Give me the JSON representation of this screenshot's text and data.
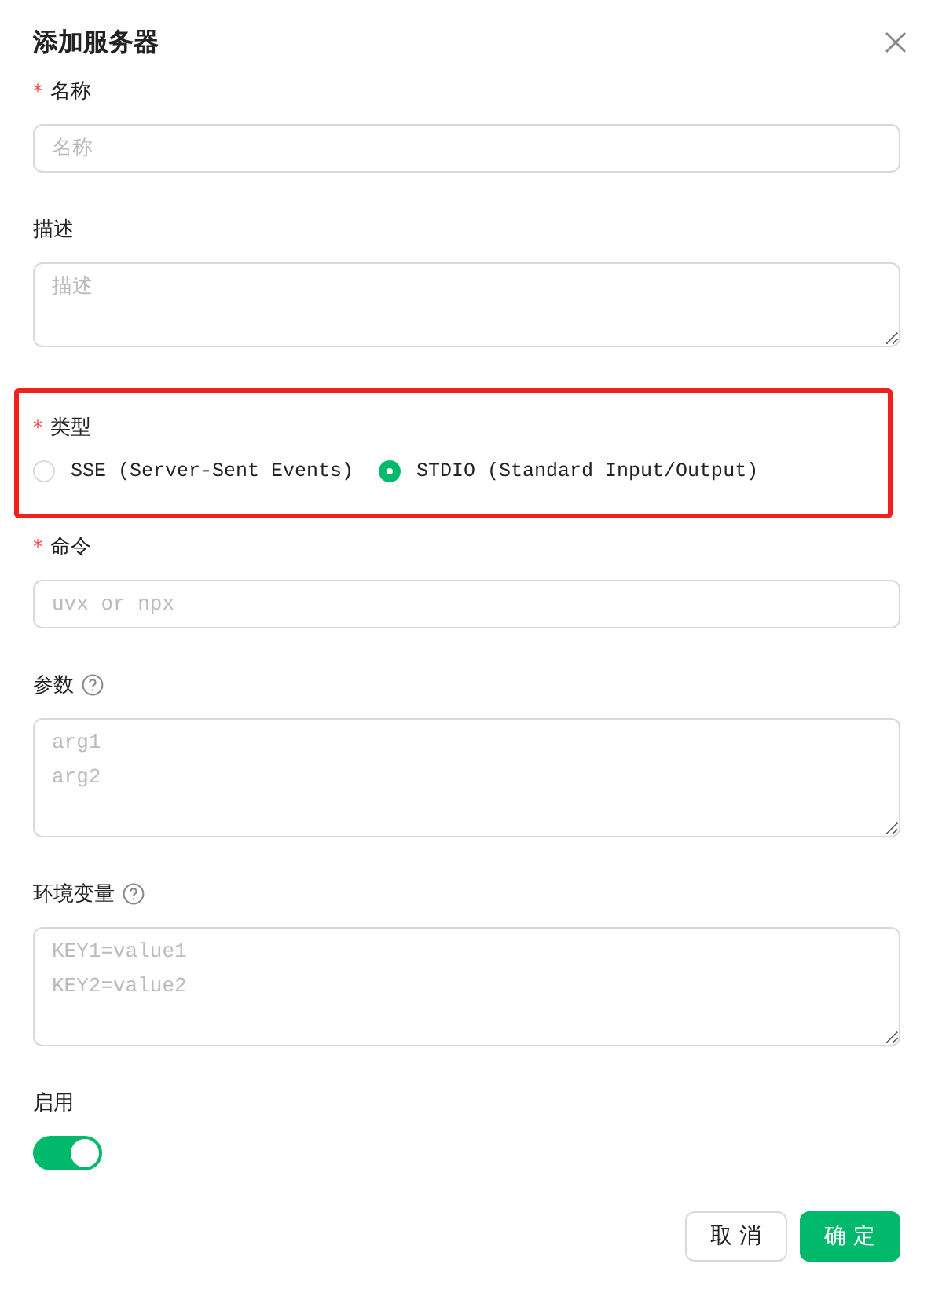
{
  "dialog": {
    "title": "添加服务器"
  },
  "fields": [
    {
      "kind": "input",
      "label": "名称",
      "required_mark": "*",
      "placeholder": "名称"
    },
    {
      "kind": "textarea",
      "label": "描述",
      "placeholder": "描述"
    },
    {
      "kind": "radio",
      "label": "类型",
      "required_mark": "*",
      "highlighted": true,
      "options": [
        {
          "label": "SSE (Server-Sent Events)",
          "selected": false
        },
        {
          "label": "STDIO (Standard Input/Output)",
          "selected": true
        }
      ]
    },
    {
      "kind": "input",
      "label": "命令",
      "required_mark": "*",
      "placeholder": "uvx or npx",
      "mono": true
    },
    {
      "kind": "textarea",
      "label": "参数",
      "help": true,
      "placeholder": "arg1\narg2",
      "mono": true
    },
    {
      "kind": "textarea",
      "label": "环境变量",
      "help": true,
      "placeholder": "KEY1=value1\nKEY2=value2",
      "mono": true
    },
    {
      "kind": "switch",
      "label": "启用",
      "on": true
    }
  ],
  "buttons": [
    {
      "label": "取 消",
      "kind": "secondary"
    },
    {
      "label": "确 定",
      "kind": "primary"
    }
  ]
}
